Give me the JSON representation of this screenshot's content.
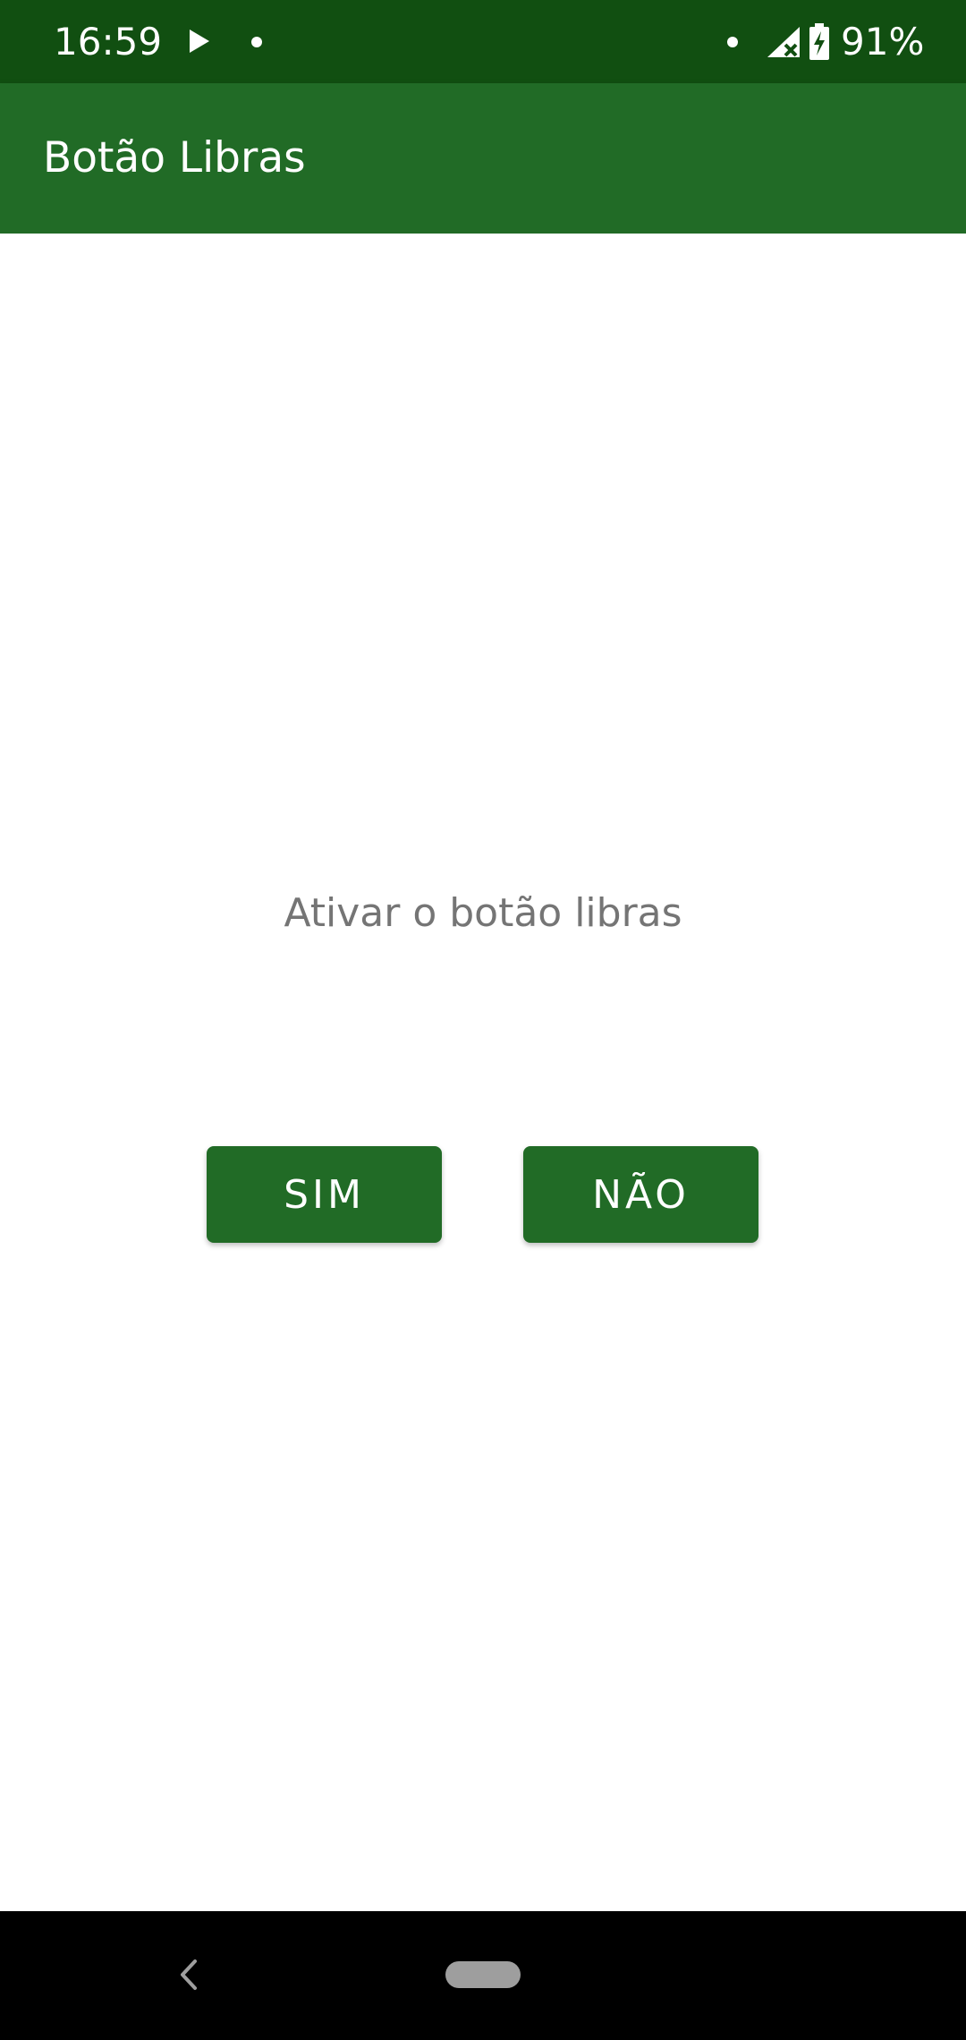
{
  "status_bar": {
    "time": "16:59",
    "battery_percent": "91%",
    "icons": [
      "play-icon",
      "notification-dot-icon",
      "signal-icon",
      "battery-charging-icon"
    ]
  },
  "app_bar": {
    "title": "Botão Libras"
  },
  "main": {
    "prompt": "Ativar o botão libras",
    "yes_label": "SIM",
    "no_label": "NÃO"
  },
  "colors": {
    "status_bar": "#114f11",
    "primary": "#216b26",
    "prompt_text": "#757575",
    "nav_bar": "#000000"
  },
  "nav_bar": {
    "icons": [
      "back-icon",
      "home-pill-icon"
    ]
  }
}
